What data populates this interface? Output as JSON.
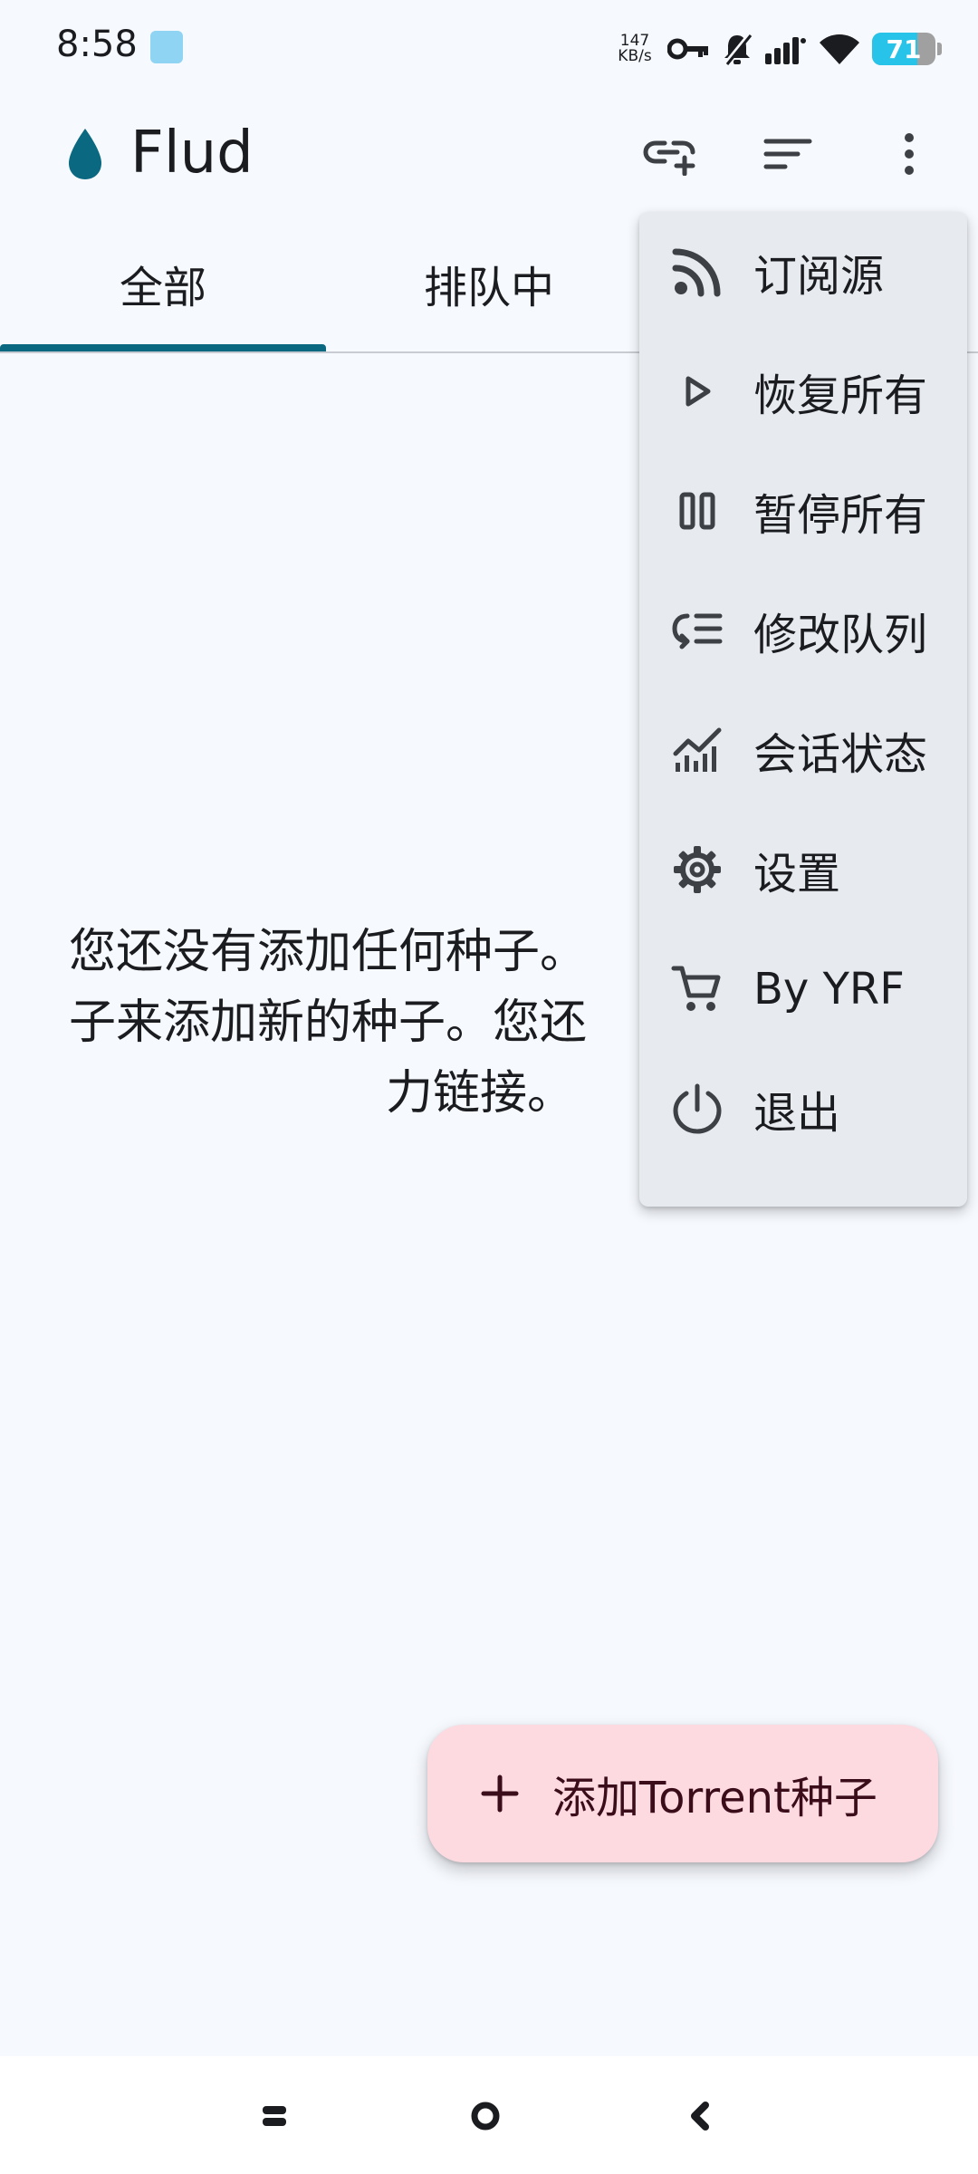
{
  "status_bar": {
    "time": "8:58",
    "net_speed_value": "147",
    "net_speed_unit": "KB/s",
    "battery": "71"
  },
  "app_bar": {
    "title": "Flud",
    "logo_color": "#0b6881"
  },
  "tabs": [
    {
      "label": "全部",
      "selected": true
    },
    {
      "label": "排队中",
      "selected": false
    }
  ],
  "empty_state": {
    "line1": "您还没有添加任何种子。",
    "line2": "子来添加新的种子。您还",
    "line3": "力链接。"
  },
  "menu": {
    "items": [
      {
        "label": "订阅源",
        "icon": "rss-icon"
      },
      {
        "label": "恢复所有",
        "icon": "play-icon"
      },
      {
        "label": "暂停所有",
        "icon": "pause-icon"
      },
      {
        "label": "修改队列",
        "icon": "queue-icon"
      },
      {
        "label": "会话状态",
        "icon": "chart-icon"
      },
      {
        "label": "设置",
        "icon": "gear-icon"
      },
      {
        "label": "By YRF",
        "icon": "cart-icon"
      },
      {
        "label": "退出",
        "icon": "power-icon"
      }
    ]
  },
  "fab": {
    "label": "添加Torrent种子"
  },
  "colors": {
    "accent": "#0b6881",
    "fab_bg": "#fdd9e0",
    "menu_bg": "#e7ebf0",
    "page_bg": "#f6f9fe"
  }
}
